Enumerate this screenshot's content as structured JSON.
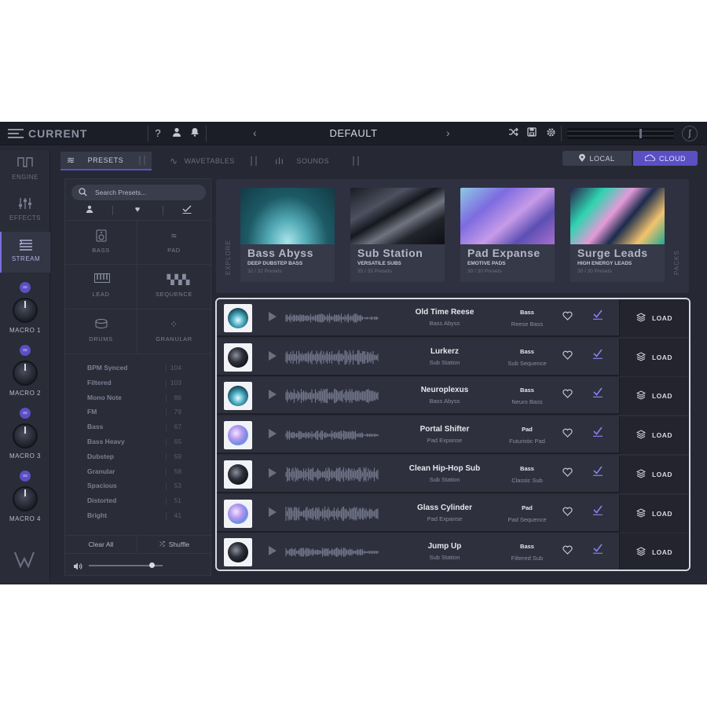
{
  "app": {
    "name": "CURRENT",
    "preset_name": "DEFAULT"
  },
  "topbar": {
    "help": "?",
    "prev": "‹",
    "next": "›"
  },
  "nav": [
    {
      "label": "ENGINE",
      "icon": "engine-icon"
    },
    {
      "label": "EFFECTS",
      "icon": "effects-icon"
    },
    {
      "label": "STREAM",
      "icon": "stream-icon",
      "active": true
    }
  ],
  "macros": [
    {
      "label": "MACRO 1"
    },
    {
      "label": "MACRO 2"
    },
    {
      "label": "MACRO 3"
    },
    {
      "label": "MACRO 4"
    }
  ],
  "tabs": {
    "presets": "PRESETS",
    "wavetables": "WAVETABLES",
    "sounds": "SOUNDS"
  },
  "source": {
    "local": "LOCAL",
    "cloud": "CLOUD",
    "selected": "CLOUD"
  },
  "browser": {
    "search_placeholder": "Search Presets...",
    "categories": [
      "BASS",
      "PAD",
      "LEAD",
      "SEQUENCE",
      "DRUMS",
      "GRANULAR"
    ],
    "tags": [
      {
        "name": "BPM Synced",
        "count": "104"
      },
      {
        "name": "Filtered",
        "count": "103"
      },
      {
        "name": "Mono Note",
        "count": "86"
      },
      {
        "name": "FM",
        "count": "79"
      },
      {
        "name": "Bass",
        "count": "67"
      },
      {
        "name": "Bass Heavy",
        "count": "65"
      },
      {
        "name": "Dubstep",
        "count": "59"
      },
      {
        "name": "Granular",
        "count": "58"
      },
      {
        "name": "Spacious",
        "count": "53"
      },
      {
        "name": "Distorted",
        "count": "51"
      },
      {
        "name": "Bright",
        "count": "41"
      }
    ],
    "clear_all": "Clear All",
    "shuffle": "Shuffle",
    "volume": 0.85
  },
  "packs_section": {
    "left_label": "EXPLORE",
    "right_label": "PACKS"
  },
  "packs": [
    {
      "title": "Bass Abyss",
      "subtitle": "DEEP DUBSTEP BASS",
      "count": "32 / 32 Presets"
    },
    {
      "title": "Sub Station",
      "subtitle": "VERSATILE SUBS",
      "count": "35 / 35 Presets"
    },
    {
      "title": "Pad Expanse",
      "subtitle": "EMOTIVE PADS",
      "count": "30 / 30 Presets"
    },
    {
      "title": "Surge Leads",
      "subtitle": "HIGH ENERGY LEADS",
      "count": "30 / 30 Presets"
    }
  ],
  "presets": [
    {
      "name": "Old Time Reese",
      "pack": "Bass Abyss",
      "type": "Bass",
      "subtype": "Reese Bass",
      "thumb": "abyss"
    },
    {
      "name": "Lurkerz",
      "pack": "Sub Station",
      "type": "Bass",
      "subtype": "Sub Sequence",
      "thumb": "sub"
    },
    {
      "name": "Neuroplexus",
      "pack": "Bass Abyss",
      "type": "Bass",
      "subtype": "Neuro Bass",
      "thumb": "abyss"
    },
    {
      "name": "Portal Shifter",
      "pack": "Pad Expanse",
      "type": "Pad",
      "subtype": "Futuristic Pad",
      "thumb": "pad"
    },
    {
      "name": "Clean Hip-Hop Sub",
      "pack": "Sub Station",
      "type": "Bass",
      "subtype": "Classic Sub",
      "thumb": "sub"
    },
    {
      "name": "Glass Cylinder",
      "pack": "Pad Expanse",
      "type": "Pad",
      "subtype": "Pad Sequence",
      "thumb": "pad"
    },
    {
      "name": "Jump Up",
      "pack": "Sub Station",
      "type": "Bass",
      "subtype": "Filtered Sub",
      "thumb": "sub"
    }
  ],
  "load_label": "LOAD",
  "colors": {
    "accent": "#5b4fc4",
    "background": "#262833",
    "check": "#8a7ff0"
  }
}
